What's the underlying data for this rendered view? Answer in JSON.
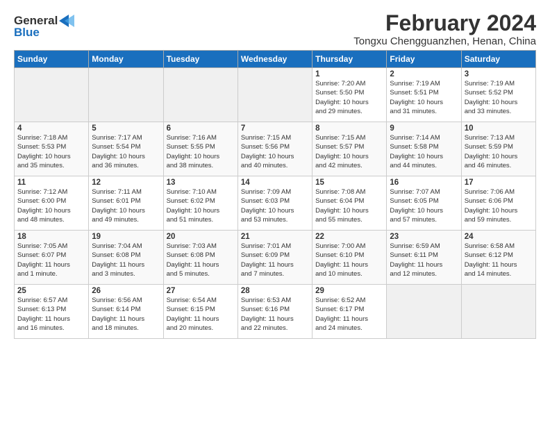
{
  "logo": {
    "line1": "General",
    "line2": "Blue"
  },
  "title": "February 2024",
  "subtitle": "Tongxu Chengguanzhen, Henan, China",
  "days_of_week": [
    "Sunday",
    "Monday",
    "Tuesday",
    "Wednesday",
    "Thursday",
    "Friday",
    "Saturday"
  ],
  "weeks": [
    [
      {
        "num": "",
        "detail": "",
        "empty": true
      },
      {
        "num": "",
        "detail": "",
        "empty": true
      },
      {
        "num": "",
        "detail": "",
        "empty": true
      },
      {
        "num": "",
        "detail": "",
        "empty": true
      },
      {
        "num": "1",
        "detail": "Sunrise: 7:20 AM\nSunset: 5:50 PM\nDaylight: 10 hours\nand 29 minutes."
      },
      {
        "num": "2",
        "detail": "Sunrise: 7:19 AM\nSunset: 5:51 PM\nDaylight: 10 hours\nand 31 minutes."
      },
      {
        "num": "3",
        "detail": "Sunrise: 7:19 AM\nSunset: 5:52 PM\nDaylight: 10 hours\nand 33 minutes."
      }
    ],
    [
      {
        "num": "4",
        "detail": "Sunrise: 7:18 AM\nSunset: 5:53 PM\nDaylight: 10 hours\nand 35 minutes."
      },
      {
        "num": "5",
        "detail": "Sunrise: 7:17 AM\nSunset: 5:54 PM\nDaylight: 10 hours\nand 36 minutes."
      },
      {
        "num": "6",
        "detail": "Sunrise: 7:16 AM\nSunset: 5:55 PM\nDaylight: 10 hours\nand 38 minutes."
      },
      {
        "num": "7",
        "detail": "Sunrise: 7:15 AM\nSunset: 5:56 PM\nDaylight: 10 hours\nand 40 minutes."
      },
      {
        "num": "8",
        "detail": "Sunrise: 7:15 AM\nSunset: 5:57 PM\nDaylight: 10 hours\nand 42 minutes."
      },
      {
        "num": "9",
        "detail": "Sunrise: 7:14 AM\nSunset: 5:58 PM\nDaylight: 10 hours\nand 44 minutes."
      },
      {
        "num": "10",
        "detail": "Sunrise: 7:13 AM\nSunset: 5:59 PM\nDaylight: 10 hours\nand 46 minutes."
      }
    ],
    [
      {
        "num": "11",
        "detail": "Sunrise: 7:12 AM\nSunset: 6:00 PM\nDaylight: 10 hours\nand 48 minutes."
      },
      {
        "num": "12",
        "detail": "Sunrise: 7:11 AM\nSunset: 6:01 PM\nDaylight: 10 hours\nand 49 minutes."
      },
      {
        "num": "13",
        "detail": "Sunrise: 7:10 AM\nSunset: 6:02 PM\nDaylight: 10 hours\nand 51 minutes."
      },
      {
        "num": "14",
        "detail": "Sunrise: 7:09 AM\nSunset: 6:03 PM\nDaylight: 10 hours\nand 53 minutes."
      },
      {
        "num": "15",
        "detail": "Sunrise: 7:08 AM\nSunset: 6:04 PM\nDaylight: 10 hours\nand 55 minutes."
      },
      {
        "num": "16",
        "detail": "Sunrise: 7:07 AM\nSunset: 6:05 PM\nDaylight: 10 hours\nand 57 minutes."
      },
      {
        "num": "17",
        "detail": "Sunrise: 7:06 AM\nSunset: 6:06 PM\nDaylight: 10 hours\nand 59 minutes."
      }
    ],
    [
      {
        "num": "18",
        "detail": "Sunrise: 7:05 AM\nSunset: 6:07 PM\nDaylight: 11 hours\nand 1 minute."
      },
      {
        "num": "19",
        "detail": "Sunrise: 7:04 AM\nSunset: 6:08 PM\nDaylight: 11 hours\nand 3 minutes."
      },
      {
        "num": "20",
        "detail": "Sunrise: 7:03 AM\nSunset: 6:08 PM\nDaylight: 11 hours\nand 5 minutes."
      },
      {
        "num": "21",
        "detail": "Sunrise: 7:01 AM\nSunset: 6:09 PM\nDaylight: 11 hours\nand 7 minutes."
      },
      {
        "num": "22",
        "detail": "Sunrise: 7:00 AM\nSunset: 6:10 PM\nDaylight: 11 hours\nand 10 minutes."
      },
      {
        "num": "23",
        "detail": "Sunrise: 6:59 AM\nSunset: 6:11 PM\nDaylight: 11 hours\nand 12 minutes."
      },
      {
        "num": "24",
        "detail": "Sunrise: 6:58 AM\nSunset: 6:12 PM\nDaylight: 11 hours\nand 14 minutes."
      }
    ],
    [
      {
        "num": "25",
        "detail": "Sunrise: 6:57 AM\nSunset: 6:13 PM\nDaylight: 11 hours\nand 16 minutes."
      },
      {
        "num": "26",
        "detail": "Sunrise: 6:56 AM\nSunset: 6:14 PM\nDaylight: 11 hours\nand 18 minutes."
      },
      {
        "num": "27",
        "detail": "Sunrise: 6:54 AM\nSunset: 6:15 PM\nDaylight: 11 hours\nand 20 minutes."
      },
      {
        "num": "28",
        "detail": "Sunrise: 6:53 AM\nSunset: 6:16 PM\nDaylight: 11 hours\nand 22 minutes."
      },
      {
        "num": "29",
        "detail": "Sunrise: 6:52 AM\nSunset: 6:17 PM\nDaylight: 11 hours\nand 24 minutes."
      },
      {
        "num": "",
        "detail": "",
        "empty": true
      },
      {
        "num": "",
        "detail": "",
        "empty": true
      }
    ]
  ]
}
